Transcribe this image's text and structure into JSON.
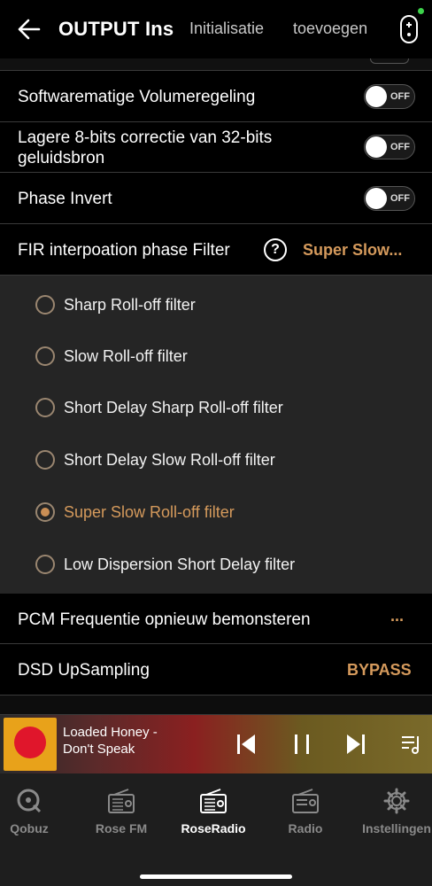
{
  "header": {
    "title": "OUTPUT Ins",
    "tabs": [
      "Initialisatie",
      "toevoegen"
    ]
  },
  "settings": [
    {
      "label": "Softwarematige Volumeregeling",
      "toggle": "OFF"
    },
    {
      "label": "Lagere 8-bits correctie van 32-bits geluidsbron",
      "toggle": "OFF"
    },
    {
      "label": "Phase Invert",
      "toggle": "OFF"
    }
  ],
  "fir": {
    "label": "FIR interpoation phase Filter",
    "help": "?",
    "value": "Super Slow..."
  },
  "filter_options": [
    {
      "label": "Sharp Roll-off filter",
      "selected": false
    },
    {
      "label": "Slow Roll-off filter",
      "selected": false
    },
    {
      "label": "Short Delay Sharp Roll-off filter",
      "selected": false
    },
    {
      "label": "Short Delay Slow Roll-off filter",
      "selected": false
    },
    {
      "label": "Super Slow Roll-off filter",
      "selected": true
    },
    {
      "label": "Low Dispersion Short Delay filter",
      "selected": false
    }
  ],
  "pcm": {
    "label": "PCM Frequentie opnieuw bemonsteren",
    "value": "..."
  },
  "dsd": {
    "label": "DSD UpSampling",
    "value": "BYPASS"
  },
  "player": {
    "line1": "Loaded Honey -",
    "line2": "Don't Speak"
  },
  "nav": [
    {
      "label": "Qobuz",
      "icon": "qobuz-icon"
    },
    {
      "label": "Rose FM",
      "icon": "radio-icon"
    },
    {
      "label": "RoseRadio",
      "icon": "radio-icon",
      "active": true
    },
    {
      "label": "Radio",
      "icon": "radio-icon"
    },
    {
      "label": "Instellingen",
      "icon": "gear-icon"
    }
  ],
  "colors": {
    "accent": "#d59a5c",
    "background": "#000000",
    "panel": "#252525"
  }
}
